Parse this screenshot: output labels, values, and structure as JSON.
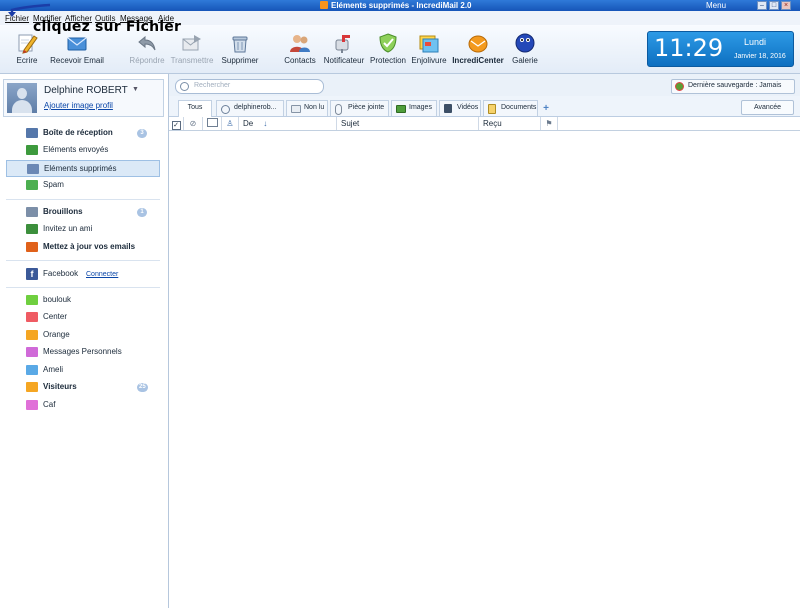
{
  "window": {
    "title": "Eléments supprimés - IncrediMail 2.0",
    "menu_label": "Menu",
    "minimize_icon": "minimize-icon",
    "maximize_icon": "maximize-icon",
    "close_icon": "close-icon"
  },
  "menubar": {
    "items": [
      "Fichier",
      "Modifier",
      "Afficher",
      "Outils",
      "Message",
      "Aide"
    ]
  },
  "annotation": {
    "text": "cliquez sur Fichier"
  },
  "toolbar": {
    "items": [
      {
        "label": "Ecrire",
        "icon": "pencil-icon",
        "enabled": true
      },
      {
        "label": "Recevoir Email",
        "icon": "envelope-icon",
        "enabled": true
      },
      {
        "label": "Répondre",
        "icon": "reply-arrow-icon",
        "enabled": false
      },
      {
        "label": "Transmettre",
        "icon": "forward-envelope-icon",
        "enabled": false
      },
      {
        "label": "Supprimer",
        "icon": "trash-can-icon",
        "enabled": true
      },
      {
        "label": "Contacts",
        "icon": "contacts-icon",
        "enabled": true
      },
      {
        "label": "Notificateur",
        "icon": "mailbox-icon",
        "enabled": true
      },
      {
        "label": "Protection",
        "icon": "shield-check-icon",
        "enabled": true
      },
      {
        "label": "Enjolivure",
        "icon": "stationery-icon",
        "enabled": true
      },
      {
        "label": "IncrediCenter",
        "icon": "incredicenter-icon",
        "enabled": true
      },
      {
        "label": "Galerie",
        "icon": "gallery-icon",
        "enabled": true
      }
    ]
  },
  "clock": {
    "time": "11:29",
    "day": "Lundi",
    "date": "Janvier 18, 2016",
    "color": "#1a84d6"
  },
  "profile": {
    "name": "Delphine ROBERT",
    "link": "Ajouter image profil"
  },
  "folders": {
    "group1": [
      {
        "label": "Boîte de réception",
        "bold": true,
        "badge": "3",
        "icon": "inbox-icon",
        "color": "#5577aa"
      },
      {
        "label": "Eléments envoyés",
        "bold": false,
        "badge": "",
        "icon": "sent-icon",
        "color": "#3d9a3d"
      },
      {
        "label": "Eléments supprimés",
        "bold": false,
        "badge": "",
        "icon": "trash-icon",
        "color": "#6b88b5",
        "selected": true
      },
      {
        "label": "Spam",
        "bold": false,
        "badge": "",
        "icon": "spam-shield-icon",
        "color": "#4caf50"
      }
    ],
    "group2": [
      {
        "label": "Brouillons",
        "bold": true,
        "badge": "1",
        "icon": "drafts-icon",
        "color": "#7c8fa8"
      },
      {
        "label": "Invitez un ami",
        "bold": false,
        "badge": "",
        "icon": "invite-friend-icon",
        "color": "#3c8f3c"
      },
      {
        "label": "Mettez à jour vos emails",
        "bold": true,
        "badge": "",
        "icon": "update-emails-icon",
        "color": "#e0611a"
      }
    ],
    "facebook": {
      "label": "Facebook",
      "link": "Connecter",
      "icon": "facebook-icon",
      "color": "#3b5998"
    },
    "group3": [
      {
        "label": "boulouk",
        "bold": false,
        "badge": "",
        "icon": "folder-icon",
        "color": "#6fcf3f"
      },
      {
        "label": "Center",
        "bold": false,
        "badge": "",
        "icon": "folder-icon",
        "color": "#ef5b63"
      },
      {
        "label": "Orange",
        "bold": false,
        "badge": "",
        "icon": "folder-icon",
        "color": "#f5a623"
      },
      {
        "label": "Messages Personnels",
        "bold": false,
        "badge": "",
        "icon": "folder-icon",
        "color": "#d06ad8"
      },
      {
        "label": "Ameli",
        "bold": false,
        "badge": "",
        "icon": "folder-icon",
        "color": "#5aa9e6"
      },
      {
        "label": "Visiteurs",
        "bold": true,
        "badge": "25",
        "icon": "folder-icon",
        "color": "#f5a623"
      },
      {
        "label": "Caf",
        "bold": false,
        "badge": "",
        "icon": "folder-icon",
        "color": "#e070d8"
      }
    ]
  },
  "search": {
    "placeholder": "Rechercher"
  },
  "backup": {
    "label": "Dernière sauvegarde : Jamais"
  },
  "tabs": [
    {
      "label": "Tous",
      "icon": "",
      "active": true
    },
    {
      "label": "delphinerob...",
      "icon": "search-icon"
    },
    {
      "label": "Non lu",
      "icon": "unread-envelope-icon"
    },
    {
      "label": "Pièce jointe",
      "icon": "paperclip-icon"
    },
    {
      "label": "Images",
      "icon": "image-icon"
    },
    {
      "label": "Vidéos",
      "icon": "video-icon"
    },
    {
      "label": "Documents",
      "icon": "document-icon"
    }
  ],
  "advanced_label": "Avancée",
  "columns": {
    "from": "De",
    "subject": "Sujet",
    "received": "Reçu"
  }
}
